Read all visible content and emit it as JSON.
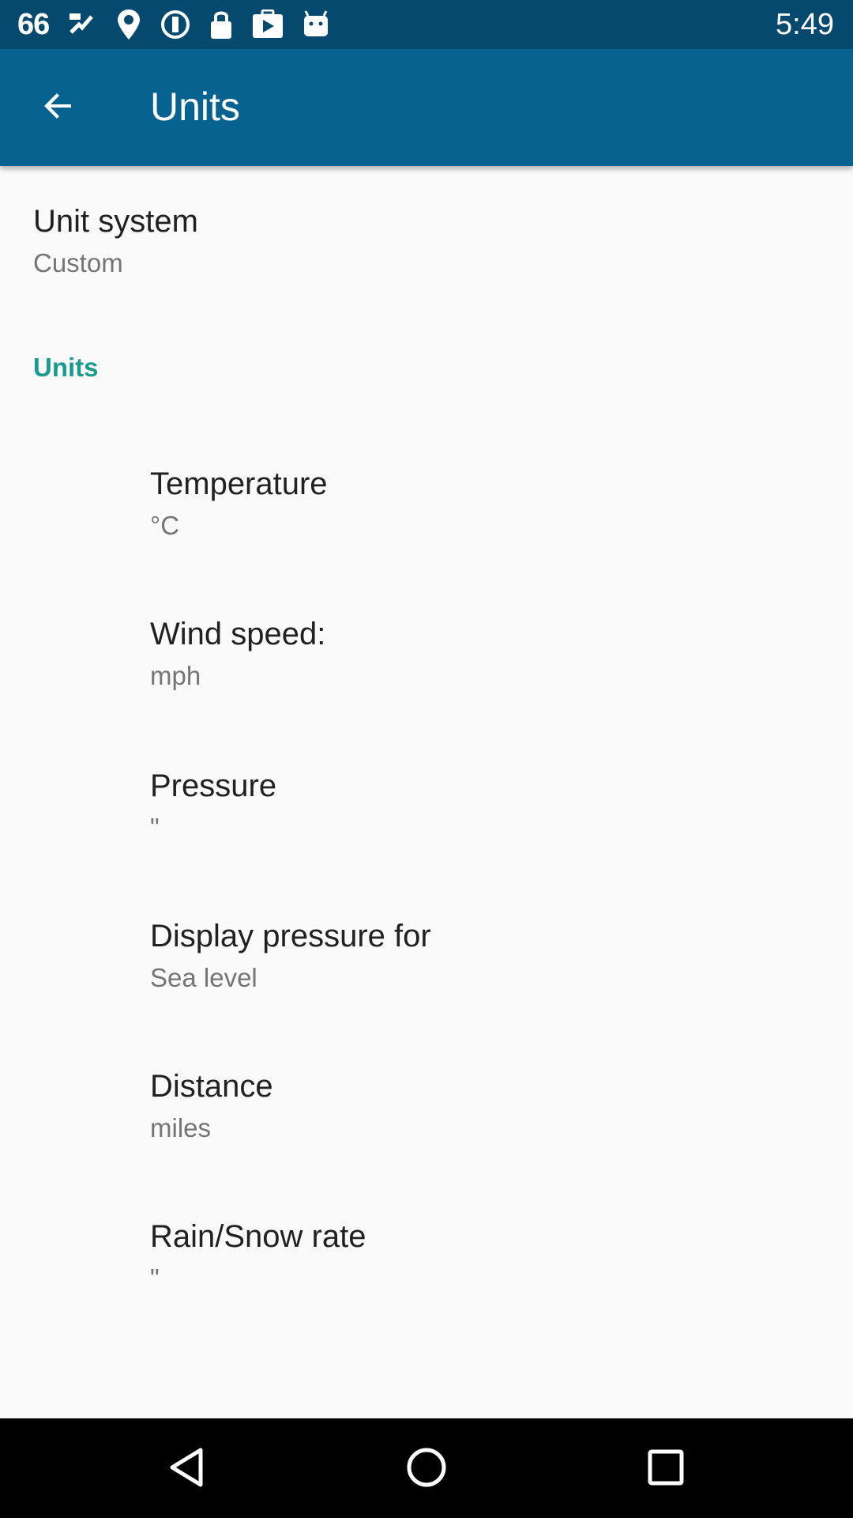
{
  "status_bar": {
    "left_text": "66",
    "icons": [
      "fake-gps-icon",
      "satellite-icon",
      "location-lock-icon",
      "sync-icon",
      "lock-icon",
      "play-store-icon",
      "android-icon"
    ],
    "time": "5:49"
  },
  "app_bar": {
    "back_icon": "arrow-back-icon",
    "title": "Units"
  },
  "unit_system": {
    "title": "Unit system",
    "summary": "Custom"
  },
  "category": {
    "label": "Units"
  },
  "units": [
    {
      "title": "Temperature",
      "summary": "°C"
    },
    {
      "title": "Wind speed:",
      "summary": "mph"
    },
    {
      "title": "Pressure",
      "summary": "\""
    },
    {
      "title": "Display pressure for",
      "summary": "Sea level"
    },
    {
      "title": "Distance",
      "summary": "miles"
    },
    {
      "title": "Rain/Snow rate",
      "summary": "\""
    }
  ],
  "nav_bar": {
    "icons": [
      "back-triangle-icon",
      "home-circle-icon",
      "recents-square-icon"
    ]
  },
  "colors": {
    "status_bar": "#054a6e",
    "app_bar": "#06628f",
    "accent": "#1a9b8f",
    "background": "#fafafa"
  }
}
